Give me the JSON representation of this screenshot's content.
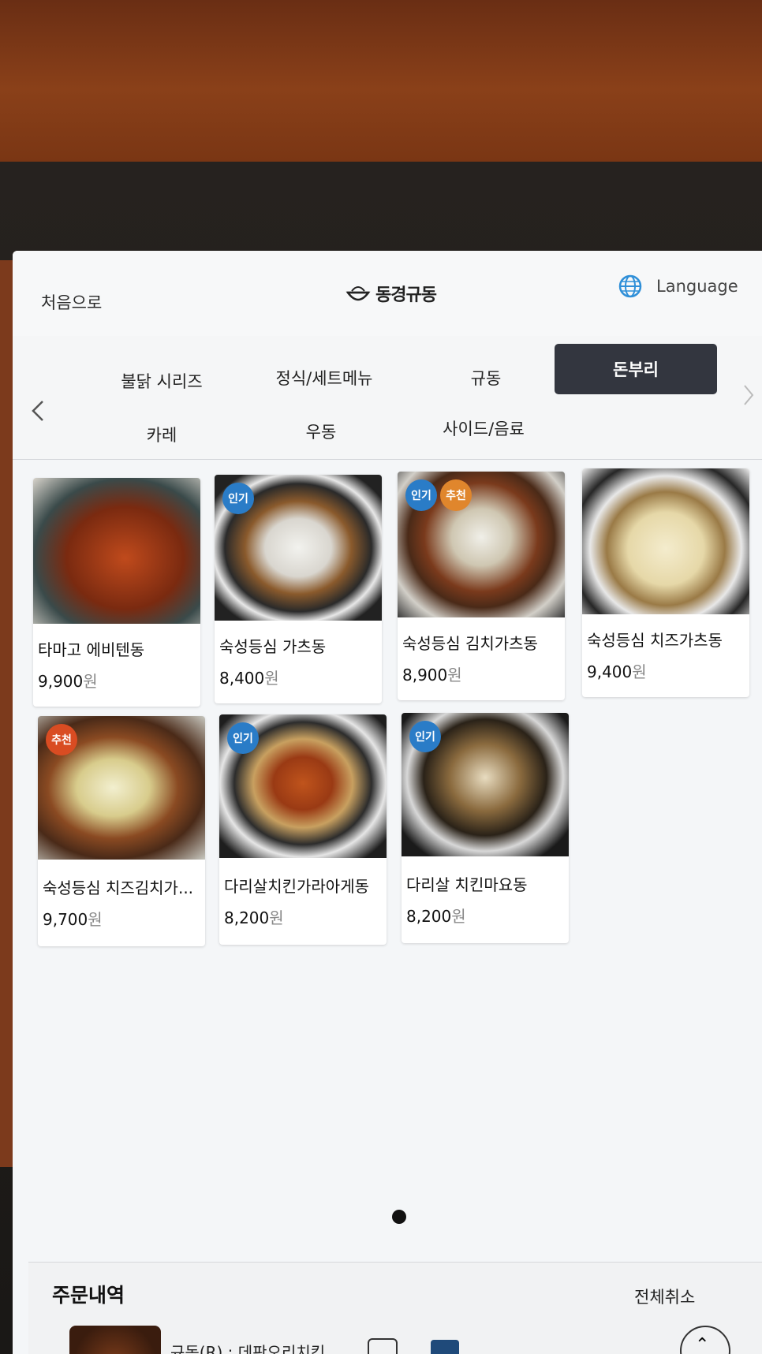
{
  "header": {
    "home_label": "처음으로",
    "logo_text": "동경규동",
    "language_label": "Language"
  },
  "categories": [
    {
      "label": "불닭 시리즈",
      "active": false
    },
    {
      "label": "정식/세트메뉴",
      "active": false
    },
    {
      "label": "규동",
      "active": false
    },
    {
      "label": "돈부리",
      "active": true
    },
    {
      "label": "카레",
      "active": false
    },
    {
      "label": "우동",
      "active": false
    },
    {
      "label": "사이드/음료",
      "active": false
    }
  ],
  "menu_items": [
    {
      "name": "타마고 에비텐동",
      "price": "9,900",
      "unit": "원",
      "badges": []
    },
    {
      "name": "숙성등심 가츠동",
      "price": "8,400",
      "unit": "원",
      "badges": [
        "인기"
      ]
    },
    {
      "name": "숙성등심 김치가츠동",
      "price": "8,900",
      "unit": "원",
      "badges": [
        "인기",
        "추천"
      ]
    },
    {
      "name": "숙성등심 치즈가츠동",
      "price": "9,400",
      "unit": "원",
      "badges": []
    },
    {
      "name": "숙성등심 치즈김치가...",
      "price": "9,700",
      "unit": "원",
      "badges": [
        "추천"
      ]
    },
    {
      "name": "다리살치킨가라아게동",
      "price": "8,200",
      "unit": "원",
      "badges": [
        "인기"
      ]
    },
    {
      "name": "다리살 치킨마요동",
      "price": "8,200",
      "unit": "원",
      "badges": [
        "인기"
      ]
    }
  ],
  "badge_labels": {
    "popular": "인기",
    "recommended": "추천"
  },
  "order": {
    "title": "주문내역",
    "cancel_all": "전체취소",
    "first_item_partial": "규동(R) : 데판오리치킨",
    "minus": "-"
  },
  "colors": {
    "active_category": "#33363f",
    "popular_badge": "#2a7cc7",
    "recommended_badge": "#e0862c"
  }
}
